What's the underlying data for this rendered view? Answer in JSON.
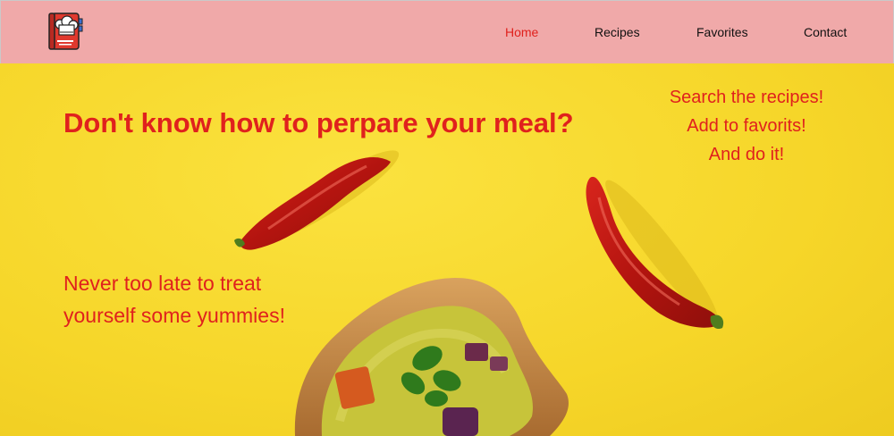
{
  "nav": {
    "items": [
      {
        "label": "Home",
        "active": true
      },
      {
        "label": "Recipes",
        "active": false
      },
      {
        "label": "Favorites",
        "active": false
      },
      {
        "label": "Contact",
        "active": false
      }
    ]
  },
  "logo": {
    "icon": "chef-recipe-book-icon"
  },
  "hero": {
    "title": "Don't know how to perpare your meal?",
    "side_lines": [
      "Search the recipes!",
      "Add to favorits!",
      "And do it!"
    ],
    "tagline_lines": [
      "Never too late to treat",
      "yourself some yummies!"
    ]
  },
  "colors": {
    "accent": "#e0211d",
    "navbar_bg": "#f0a9a9",
    "hero_bg": "#f6d629"
  }
}
